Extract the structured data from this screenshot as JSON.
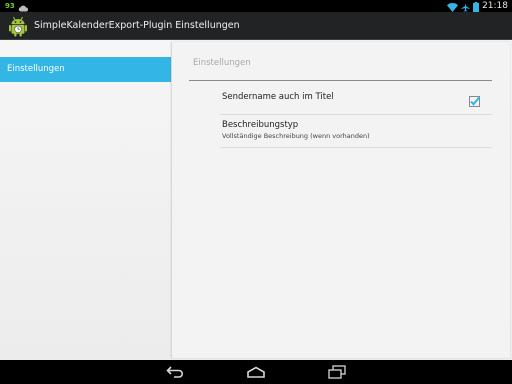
{
  "status_bar": {
    "notification_text": "93",
    "clock": "21:18",
    "icons": [
      "android-notification-icon",
      "cloud-icon",
      "wifi-icon",
      "airplane-mode-icon",
      "battery-icon"
    ]
  },
  "action_bar": {
    "title": "SimpleKalenderExport-Plugin Einstellungen",
    "app_icon": "android-robot-icon"
  },
  "sidebar": {
    "items": [
      {
        "label": "Einstellungen",
        "selected": true
      }
    ]
  },
  "detail": {
    "category_title": "Einstellungen",
    "preferences": [
      {
        "title": "Sendername auch im Titel",
        "summary": "",
        "type": "checkbox",
        "checked": true
      },
      {
        "title": "Beschreibungstyp",
        "summary": "Vollständige Beschreibung (wenn vorhanden)",
        "type": "list"
      }
    ]
  },
  "nav_bar": {
    "buttons": [
      "back-icon",
      "home-icon",
      "recents-icon"
    ]
  },
  "colors": {
    "accent": "#33b5e5",
    "action_bar": "#222325",
    "status_bar": "#000000",
    "notification_green": "#6fcf2f"
  }
}
